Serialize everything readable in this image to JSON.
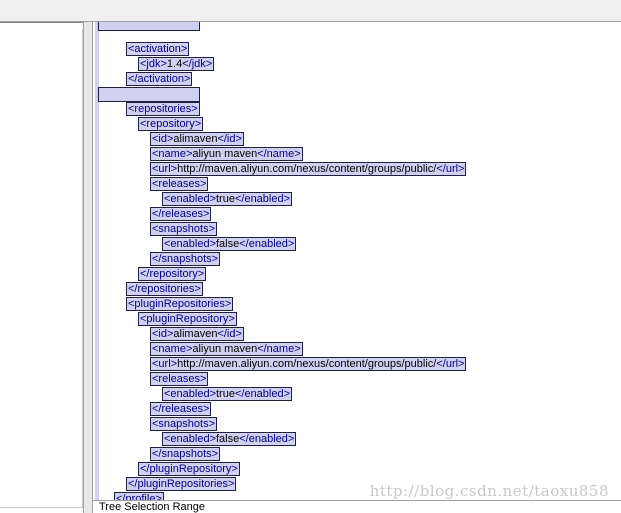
{
  "editor": {
    "lines": [
      {
        "indent": 0,
        "parts": [],
        "empty": true
      },
      {
        "indent": 1,
        "parts": [
          {
            "t": "tag",
            "v": "<activation>"
          }
        ]
      },
      {
        "indent": 2,
        "parts": [
          {
            "t": "tag",
            "v": "<jdk>"
          },
          {
            "t": "txt",
            "v": "1.4"
          },
          {
            "t": "tag",
            "v": "</jdk>"
          }
        ]
      },
      {
        "indent": 1,
        "parts": [
          {
            "t": "tag",
            "v": "</activation>"
          }
        ]
      },
      {
        "indent": 0,
        "parts": [],
        "empty": true
      },
      {
        "indent": 1,
        "parts": [
          {
            "t": "tag",
            "v": "<repositories>"
          }
        ]
      },
      {
        "indent": 2,
        "parts": [
          {
            "t": "tag",
            "v": "<repository>"
          }
        ]
      },
      {
        "indent": 3,
        "parts": [
          {
            "t": "tag",
            "v": "<id>"
          },
          {
            "t": "txt",
            "v": "alimaven"
          },
          {
            "t": "tag",
            "v": "</id>"
          }
        ]
      },
      {
        "indent": 3,
        "parts": [
          {
            "t": "tag",
            "v": "<name>"
          },
          {
            "t": "txt",
            "v": "aliyun maven"
          },
          {
            "t": "tag",
            "v": "</name>"
          }
        ]
      },
      {
        "indent": 3,
        "parts": [
          {
            "t": "tag",
            "v": "<url>"
          },
          {
            "t": "txt",
            "v": "http://maven.aliyun.com/nexus/content/groups/public/"
          },
          {
            "t": "tag",
            "v": "</url>"
          }
        ]
      },
      {
        "indent": 3,
        "parts": [
          {
            "t": "tag",
            "v": "<releases>"
          }
        ]
      },
      {
        "indent": 4,
        "parts": [
          {
            "t": "tag",
            "v": "<enabled>"
          },
          {
            "t": "txt",
            "v": "true"
          },
          {
            "t": "tag",
            "v": "</enabled>"
          }
        ]
      },
      {
        "indent": 3,
        "parts": [
          {
            "t": "tag",
            "v": "</releases>"
          }
        ]
      },
      {
        "indent": 3,
        "parts": [
          {
            "t": "tag",
            "v": "<snapshots>"
          }
        ]
      },
      {
        "indent": 4,
        "parts": [
          {
            "t": "tag",
            "v": "<enabled>"
          },
          {
            "t": "txt",
            "v": "false"
          },
          {
            "t": "tag",
            "v": "</enabled>"
          }
        ]
      },
      {
        "indent": 3,
        "parts": [
          {
            "t": "tag",
            "v": "</snapshots>"
          }
        ]
      },
      {
        "indent": 2,
        "parts": [
          {
            "t": "tag",
            "v": "</repository>"
          }
        ]
      },
      {
        "indent": 1,
        "parts": [
          {
            "t": "tag",
            "v": "</repositories>"
          }
        ]
      },
      {
        "indent": 1,
        "parts": [
          {
            "t": "tag",
            "v": "<pluginRepositories>"
          }
        ]
      },
      {
        "indent": 2,
        "parts": [
          {
            "t": "tag",
            "v": "<pluginRepository>"
          }
        ]
      },
      {
        "indent": 3,
        "parts": [
          {
            "t": "tag",
            "v": "<id>"
          },
          {
            "t": "txt",
            "v": "alimaven"
          },
          {
            "t": "tag",
            "v": "</id>"
          }
        ]
      },
      {
        "indent": 3,
        "parts": [
          {
            "t": "tag",
            "v": "<name>"
          },
          {
            "t": "txt",
            "v": "aliyun maven"
          },
          {
            "t": "tag",
            "v": "</name>"
          }
        ]
      },
      {
        "indent": 3,
        "parts": [
          {
            "t": "tag",
            "v": "<url>"
          },
          {
            "t": "txt",
            "v": "http://maven.aliyun.com/nexus/content/groups/public/"
          },
          {
            "t": "tag",
            "v": "</url>"
          }
        ]
      },
      {
        "indent": 3,
        "parts": [
          {
            "t": "tag",
            "v": "<releases>"
          }
        ]
      },
      {
        "indent": 4,
        "parts": [
          {
            "t": "tag",
            "v": "<enabled>"
          },
          {
            "t": "txt",
            "v": "true"
          },
          {
            "t": "tag",
            "v": "</enabled>"
          }
        ]
      },
      {
        "indent": 3,
        "parts": [
          {
            "t": "tag",
            "v": "</releases>"
          }
        ]
      },
      {
        "indent": 3,
        "parts": [
          {
            "t": "tag",
            "v": "<snapshots>"
          }
        ]
      },
      {
        "indent": 4,
        "parts": [
          {
            "t": "tag",
            "v": "<enabled>"
          },
          {
            "t": "txt",
            "v": "false"
          },
          {
            "t": "tag",
            "v": "</enabled>"
          }
        ]
      },
      {
        "indent": 3,
        "parts": [
          {
            "t": "tag",
            "v": "</snapshots>"
          }
        ]
      },
      {
        "indent": 2,
        "parts": [
          {
            "t": "tag",
            "v": "</pluginRepository>"
          }
        ]
      },
      {
        "indent": 1,
        "parts": [
          {
            "t": "tag",
            "v": "</pluginRepositories>"
          }
        ]
      },
      {
        "indent": 0,
        "parts": [
          {
            "t": "tag",
            "v": "</profile>"
          }
        ]
      }
    ]
  },
  "status": {
    "text": "Tree Selection Range"
  },
  "watermark": {
    "text": "http://blog.csdn.net/taoxu858"
  }
}
